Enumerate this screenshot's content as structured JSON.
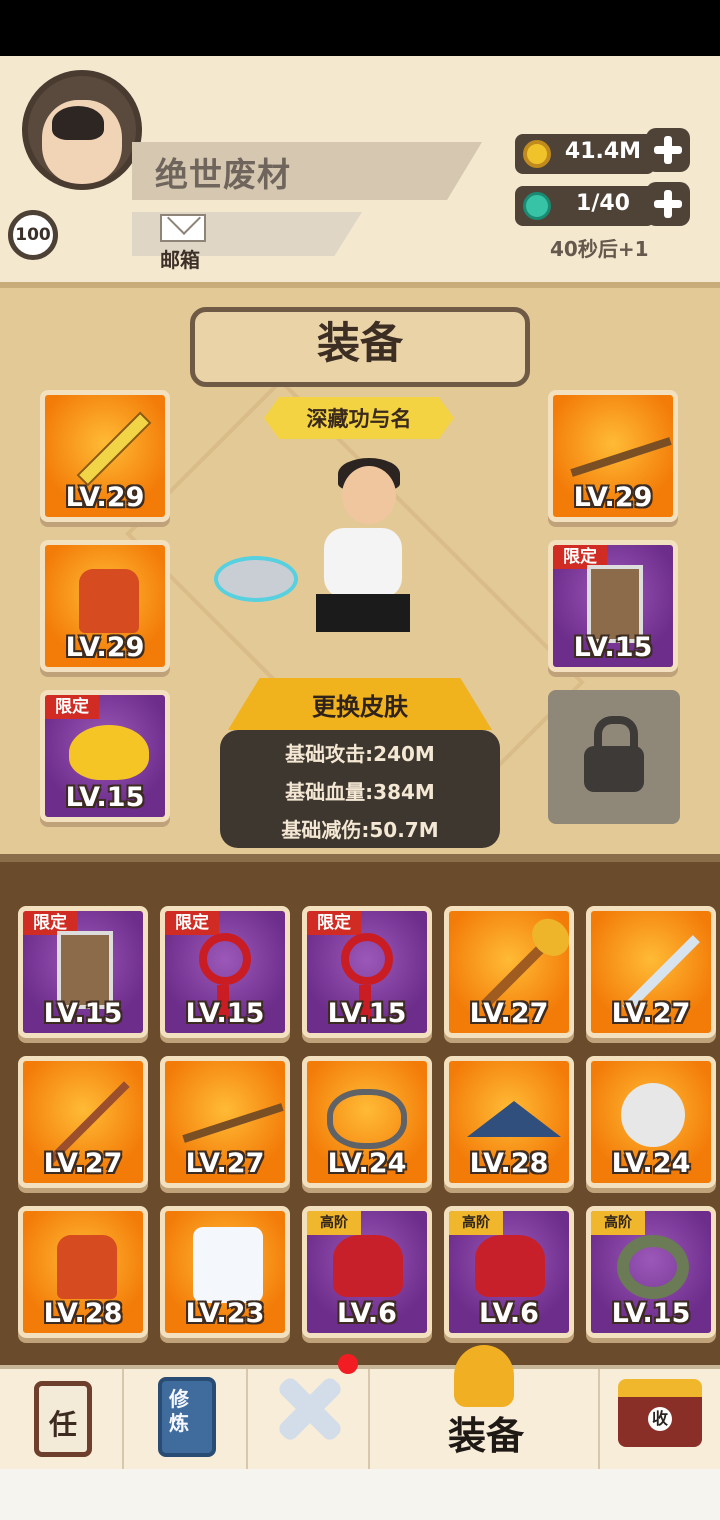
{
  "player": {
    "name": "绝世废材",
    "level": "100",
    "mail_label": "邮箱"
  },
  "resources": {
    "coins": "41.4M",
    "stamina": "1/40",
    "timer": "40秒后+1"
  },
  "equipment": {
    "title": "装备",
    "badge": "深藏功与名",
    "skin_button": "更换皮肤",
    "stats": [
      "基础攻击:240M",
      "基础血量:384M",
      "基础减伤:50.7M"
    ],
    "equipped": [
      {
        "level": "LV.29",
        "icon": "golden-sword-icon",
        "tag": ""
      },
      {
        "level": "LV.29",
        "icon": "armor-icon",
        "tag": ""
      },
      {
        "level": "LV.15",
        "icon": "golden-bell-icon",
        "tag": "限定"
      },
      {
        "level": "LV.29",
        "icon": "golden-spear-icon",
        "tag": ""
      },
      {
        "level": "LV.15",
        "icon": "banner-icon",
        "tag": "限定"
      }
    ]
  },
  "inventory": [
    {
      "level": "LV.15",
      "icon": "scroll-icon",
      "tag": "限定",
      "color": "purple"
    },
    {
      "level": "LV.15",
      "icon": "chinese-knot-icon",
      "tag": "限定",
      "color": "purple"
    },
    {
      "level": "LV.15",
      "icon": "chinese-knot-icon",
      "tag": "限定",
      "color": "purple"
    },
    {
      "level": "LV.27",
      "icon": "mace-icon",
      "tag": "",
      "color": "orange"
    },
    {
      "level": "LV.27",
      "icon": "sword-icon",
      "tag": "",
      "color": "orange"
    },
    {
      "level": "LV.27",
      "icon": "staff-icon",
      "tag": "",
      "color": "orange"
    },
    {
      "level": "LV.27",
      "icon": "spear-icon",
      "tag": "",
      "color": "orange"
    },
    {
      "level": "LV.24",
      "icon": "scissors-icon",
      "tag": "",
      "color": "orange"
    },
    {
      "level": "LV.28",
      "icon": "straw-hat-icon",
      "tag": "",
      "color": "orange"
    },
    {
      "level": "LV.24",
      "icon": "helmet-icon",
      "tag": "",
      "color": "orange"
    },
    {
      "level": "LV.28",
      "icon": "armor-icon",
      "tag": "",
      "color": "orange"
    },
    {
      "level": "LV.23",
      "icon": "robe-icon",
      "tag": "",
      "color": "orange"
    },
    {
      "level": "LV.6",
      "icon": "spiked-glove-icon",
      "tag": "高阶",
      "color": "purple"
    },
    {
      "level": "LV.6",
      "icon": "spiked-glove-icon",
      "tag": "高阶",
      "color": "purple"
    },
    {
      "level": "LV.15",
      "icon": "jade-ring-icon",
      "tag": "高阶",
      "color": "purple"
    }
  ],
  "navigation": {
    "active_label": "装备",
    "items": [
      "任",
      "修炼",
      "crossed-swords-icon",
      "装备",
      "收"
    ]
  },
  "colors": {
    "orange": "#f37c09",
    "purple": "#6d2d8b",
    "panel": "#e3c996",
    "inventory": "#6a4b2b"
  }
}
